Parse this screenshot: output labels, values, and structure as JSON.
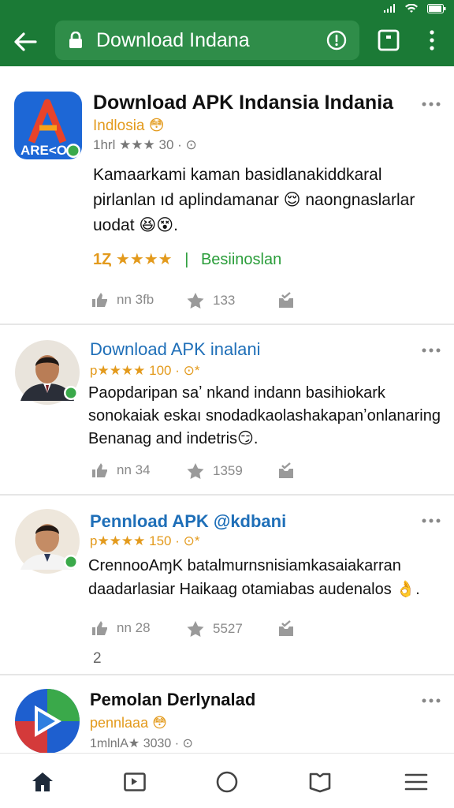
{
  "toolbar": {
    "url_text": "Download Indana"
  },
  "posts": [
    {
      "title": "Download APK Indansia Indania",
      "subtitle": "Indlosia 😳",
      "meta": "1hrl ★★★ 30 · ⊙",
      "body": [
        "Kamaarkami kaman basidlanakiddkaral",
        "pirlanlan ıd aplindamanar 😌 naongnaslarlar",
        "uodat 😆😵."
      ],
      "rating_stars": "1Ȥ ★★★★",
      "rating_label": "Besiinoslan",
      "likes": "nn 3fb",
      "stars": "133"
    },
    {
      "title": "Download APK inalani",
      "subtitle": "p★★★★ 100 · ⊙*",
      "body": [
        "Paopdaripan saʼ nkand indann basihiokark",
        "sonokaiak eskaı snodadkaolashakapanʼonlanaring",
        "Benanag and indetris😏."
      ],
      "likes": "nn 34",
      "stars": "1359"
    },
    {
      "title": "Pennload APK @kdbani",
      "subtitle": "p★★★★ 150 · ⊙*",
      "body": [
        "CrennooAɱK batalmurnsnisiamkasaiakarran",
        "daadarlasiar Haikaag otamiabas audenalos 👌."
      ],
      "likes": "nn 28",
      "stars": "5527",
      "extra": "2"
    },
    {
      "title": "Pemolan Derlynalad",
      "subtitle": "pennlaaa 😳",
      "meta": "1mlnlA★ 3030 · ⊙"
    }
  ],
  "colors": {
    "brand_green": "#1b7a36",
    "link_blue": "#1f6fb8",
    "star_orange": "#e39a1c",
    "tag_green": "#2a9d3a",
    "muted": "#8a8a8a"
  },
  "icons": {
    "status": [
      "wifi-icon",
      "signal-icon",
      "battery-icon"
    ],
    "nav": [
      "home-icon",
      "news-icon",
      "circle-icon",
      "bookmark-icon",
      "hamburger-icon"
    ]
  }
}
